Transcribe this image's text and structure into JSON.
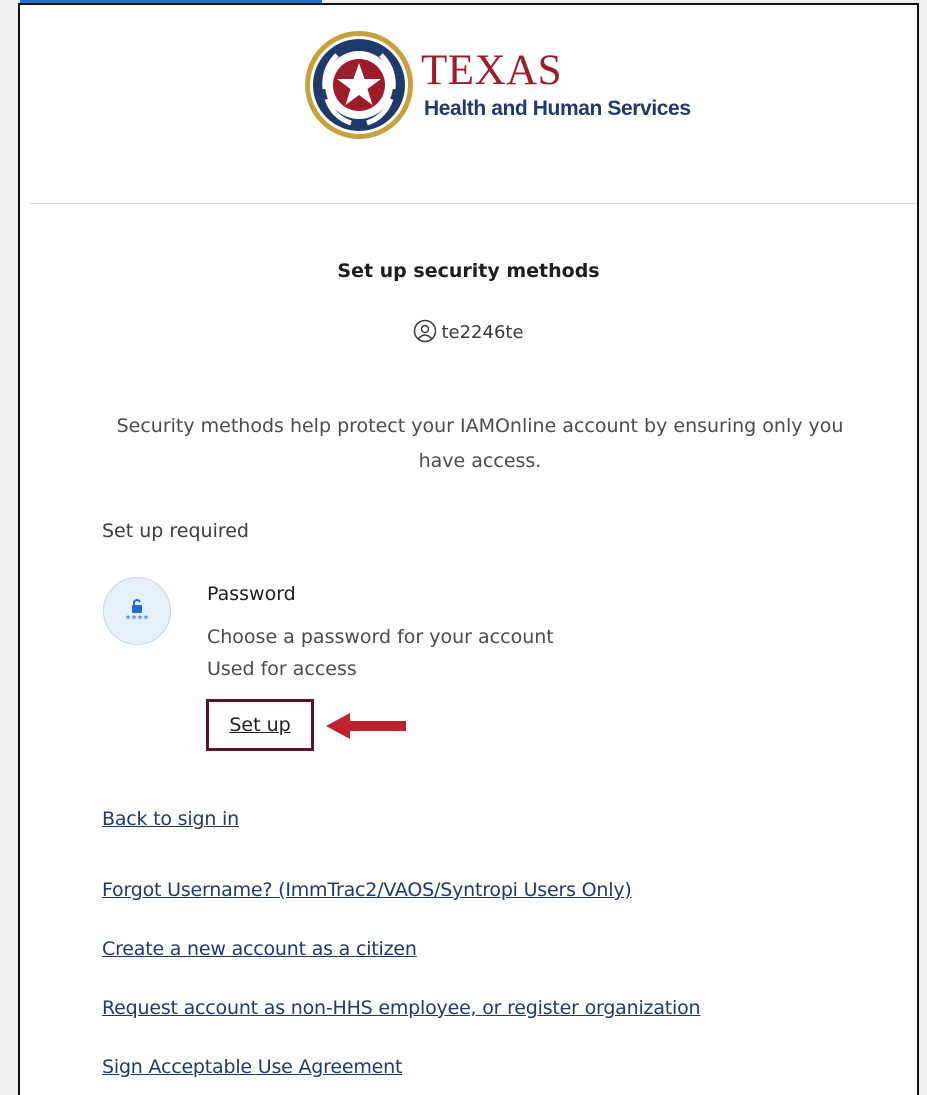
{
  "logo": {
    "title": "TEXAS",
    "subtitle": "Health and Human Services"
  },
  "page": {
    "title": "Set up security methods",
    "username": "te2246te",
    "description": "Security methods help protect your IAMOnline account by ensuring only you have access."
  },
  "required": {
    "label": "Set up required",
    "authenticator": {
      "name": "Password",
      "description_line1": "Choose a password for your account",
      "description_line2": "Used for access",
      "action_label": "Set up",
      "icon": "password-lock-icon"
    }
  },
  "links": {
    "back": "Back to sign in",
    "forgot_username": "Forgot Username? (ImmTrac2/VAOS/Syntropi Users Only)",
    "create_account": "Create a new account as a citizen",
    "request_account": "Request account as non-HHS employee, or register organization",
    "sign_agreement": "Sign Acceptable Use Agreement"
  },
  "colors": {
    "brand_red": "#9c1c2a",
    "brand_navy": "#1e3a6b",
    "callout_border": "#5b1228",
    "arrow": "#c1202e",
    "link": "#1d3a70"
  }
}
